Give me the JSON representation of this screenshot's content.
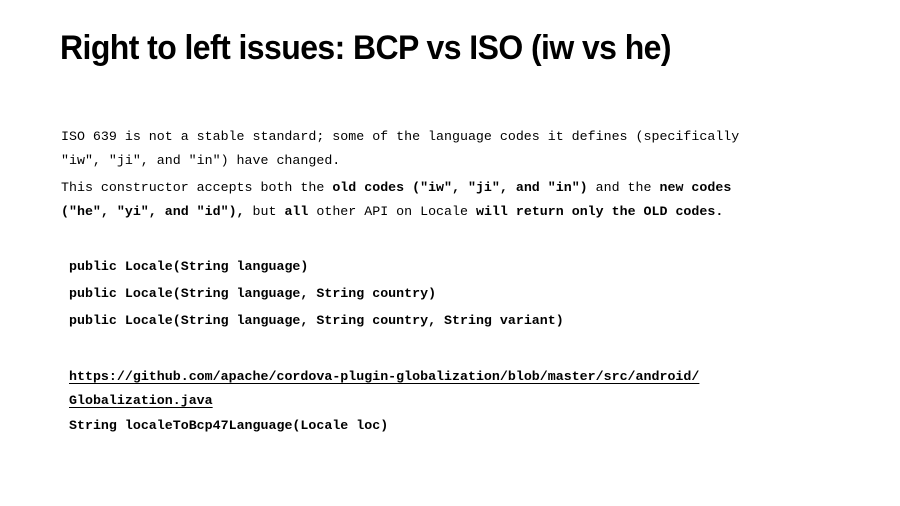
{
  "slide": {
    "title": "Right to left issues: BCP vs ISO (iw vs he)",
    "paragraph1": {
      "line1": "ISO 639 is not a stable standard; some of the language codes it defines (specifically",
      "line2": "\"iw\", \"ji\", and \"in\") have changed."
    },
    "paragraph2": {
      "line1_parts": [
        {
          "text": "This constructor accepts both the ",
          "bold": false
        },
        {
          "text": "old codes (\"iw\", \"ji\", and \"in\")",
          "bold": true
        },
        {
          "text": " and the ",
          "bold": false
        },
        {
          "text": "new codes",
          "bold": true
        }
      ],
      "line2_parts": [
        {
          "text": "(\"he\", \"yi\", and \"id\"),",
          "bold": true
        },
        {
          "text": " but ",
          "bold": false
        },
        {
          "text": "all",
          "bold": true
        },
        {
          "text": " other API on Locale ",
          "bold": false
        },
        {
          "text": "will return only the OLD codes.",
          "bold": true
        }
      ]
    },
    "constructors": [
      "public Locale(String language)",
      "public Locale(String language, String country)",
      "public Locale(String language, String country, String variant)"
    ],
    "link": {
      "line1": "https://github.com/apache/cordova-plugin-globalization/blob/master/src/android/",
      "line2": "Globalization.java"
    },
    "method_signature": "String localeToBcp47Language(Locale loc)"
  }
}
